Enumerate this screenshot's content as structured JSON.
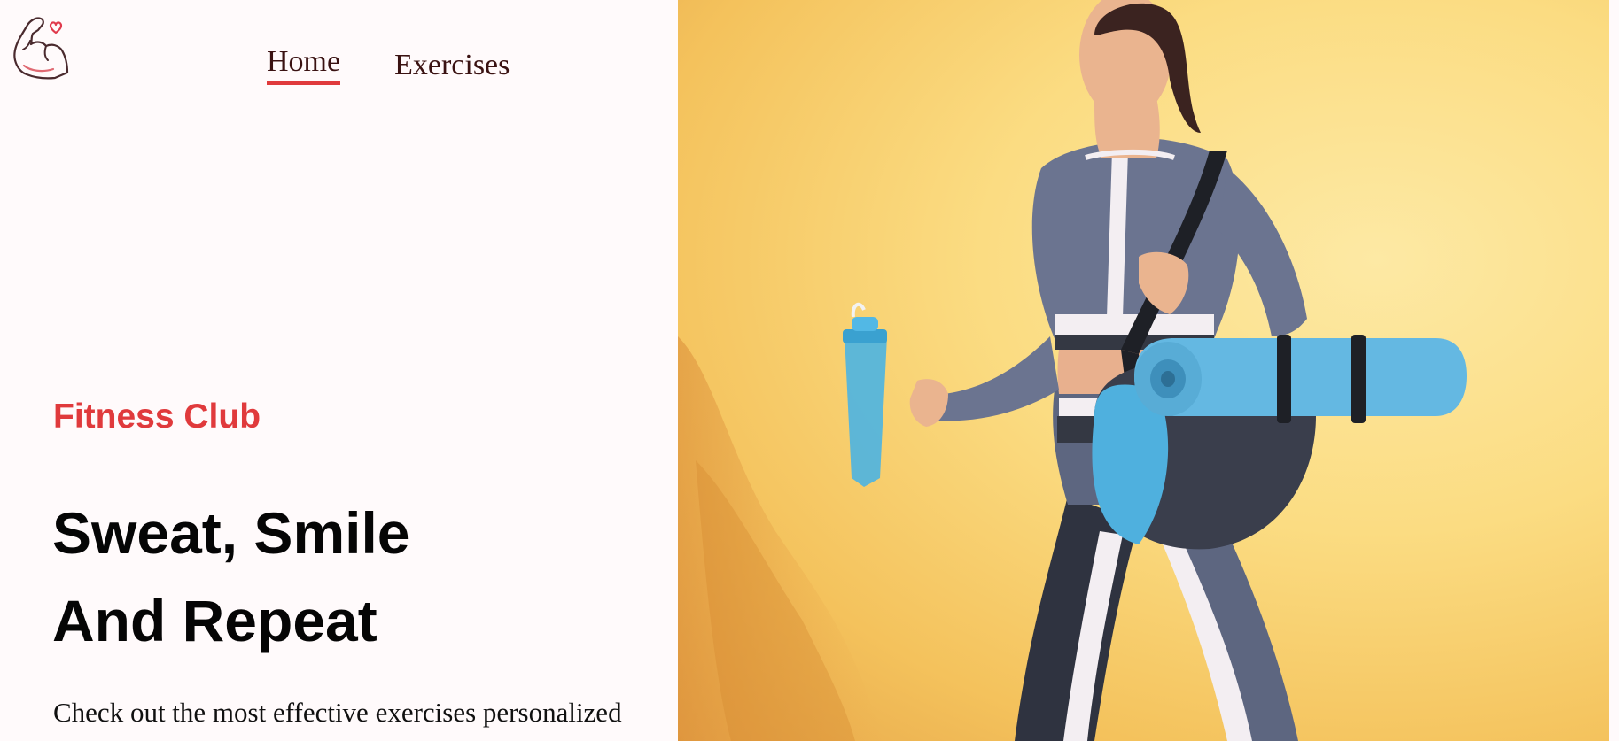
{
  "nav": {
    "items": [
      {
        "label": "Home"
      },
      {
        "label": "Exercises"
      }
    ]
  },
  "hero": {
    "eyebrow": "Fitness Club",
    "headline_line1": "Sweat, Smile",
    "headline_line2": "And Repeat",
    "subtext": "Check out the most effective exercises personalized"
  },
  "colors": {
    "accent": "#e03a3c",
    "background": "#fffafb",
    "hero_bg": "#fbdc82",
    "text": "#050505"
  },
  "icons": {
    "logo": "flexed-arm-heart-icon"
  }
}
